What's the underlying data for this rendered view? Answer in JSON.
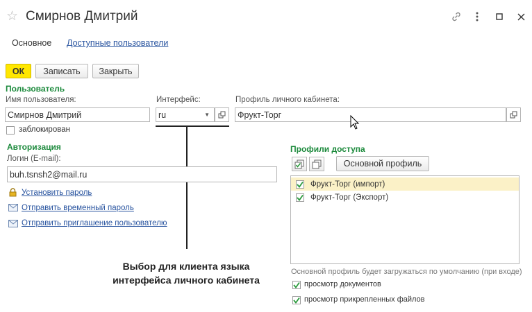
{
  "window": {
    "title": "Смирнов Дмитрий"
  },
  "tabs": [
    {
      "label": "Основное"
    },
    {
      "label": "Доступные пользователи"
    }
  ],
  "toolbar": {
    "ok_label": "ОК",
    "save_label": "Записать",
    "close_label": "Закрыть"
  },
  "user_section": {
    "heading": "Пользователь",
    "name_label": "Имя пользователя:",
    "name_value": "Смирнов Дмитрий",
    "interface_label": "Интерфейс:",
    "interface_value": "ru",
    "profile_label": "Профиль личного кабинета:",
    "profile_value": "Фрукт-Торг",
    "blocked_label": "заблокирован",
    "blocked_checked": false
  },
  "auth_section": {
    "heading": "Авторизация",
    "login_label": "Логин (E-mail):",
    "login_value": "buh.tsnsh2@mail.ru",
    "links": [
      {
        "label": "Установить пароль",
        "icon": "lock-icon"
      },
      {
        "label": "Отправить временный пароль",
        "icon": "envelope-icon"
      },
      {
        "label": "Отправить приглашение пользователю",
        "icon": "envelope-icon"
      }
    ]
  },
  "access_profiles": {
    "heading": "Профили доступа",
    "main_profile_button": "Основной профиль",
    "items": [
      {
        "label": "Фрукт-Торг (импорт)",
        "checked": true,
        "selected": true
      },
      {
        "label": "Фрукт-Торг (Экспорт)",
        "checked": true,
        "selected": false
      }
    ],
    "hint": "Основной профиль будет загружаться по умолчанию (при входе)",
    "options": [
      {
        "label": "просмотр документов",
        "checked": true
      },
      {
        "label": "просмотр прикрепленных файлов",
        "checked": true
      }
    ]
  },
  "annotation": {
    "line1": "Выбор для клиента языка",
    "line2": "интерфейса личного кабинета"
  },
  "colors": {
    "accent_green": "#1c8a3c",
    "ok_yellow": "#ffe700",
    "link_blue": "#2a55a0",
    "selection": "#fbf1c7"
  }
}
